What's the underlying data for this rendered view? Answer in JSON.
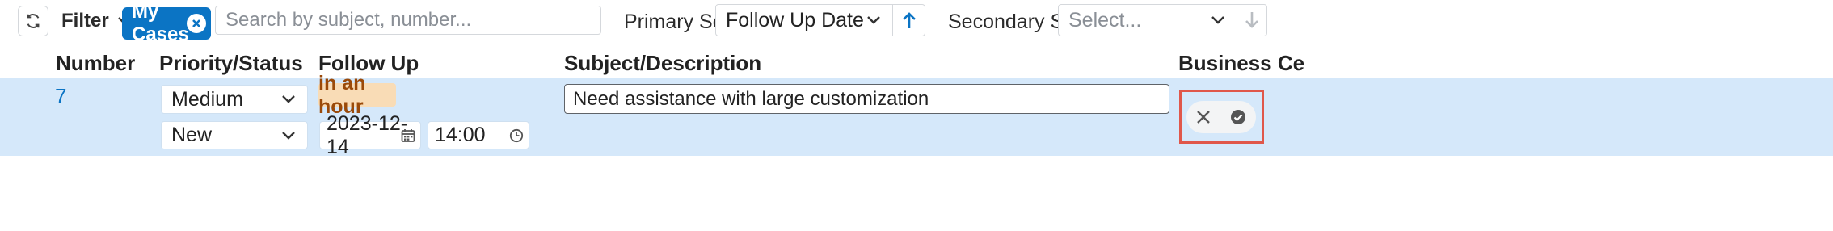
{
  "toolbar": {
    "filter_label": "Filter",
    "active_filter": "My Cases",
    "search": {
      "placeholder": "Search by subject, number..."
    },
    "primary_sort": {
      "label": "Primary Sort",
      "value": "Follow Up Date"
    },
    "secondary_sort": {
      "label": "Secondary Sort",
      "placeholder": "Select..."
    }
  },
  "columns": [
    "Number",
    "Priority/Status",
    "Follow Up",
    "Subject/Description",
    "Business Ce"
  ],
  "row": {
    "number": "7",
    "priority": "Medium",
    "status": "New",
    "follow_up_badge": "in an hour",
    "follow_up_date": "2023-12-14",
    "follow_up_time": "14:00",
    "subject": "Need assistance with large customization"
  },
  "colors": {
    "accent": "#0b74c4",
    "row_highlight": "#d5e8fa",
    "badge_bg": "#f9dcb6",
    "badge_text": "#9a4a0a",
    "highlight_border": "#e0574a"
  },
  "icons": [
    "refresh-icon",
    "chevron-down-icon",
    "close-icon",
    "arrow-up-icon",
    "arrow-down-icon",
    "calendar-icon",
    "clock-icon",
    "check-icon"
  ]
}
